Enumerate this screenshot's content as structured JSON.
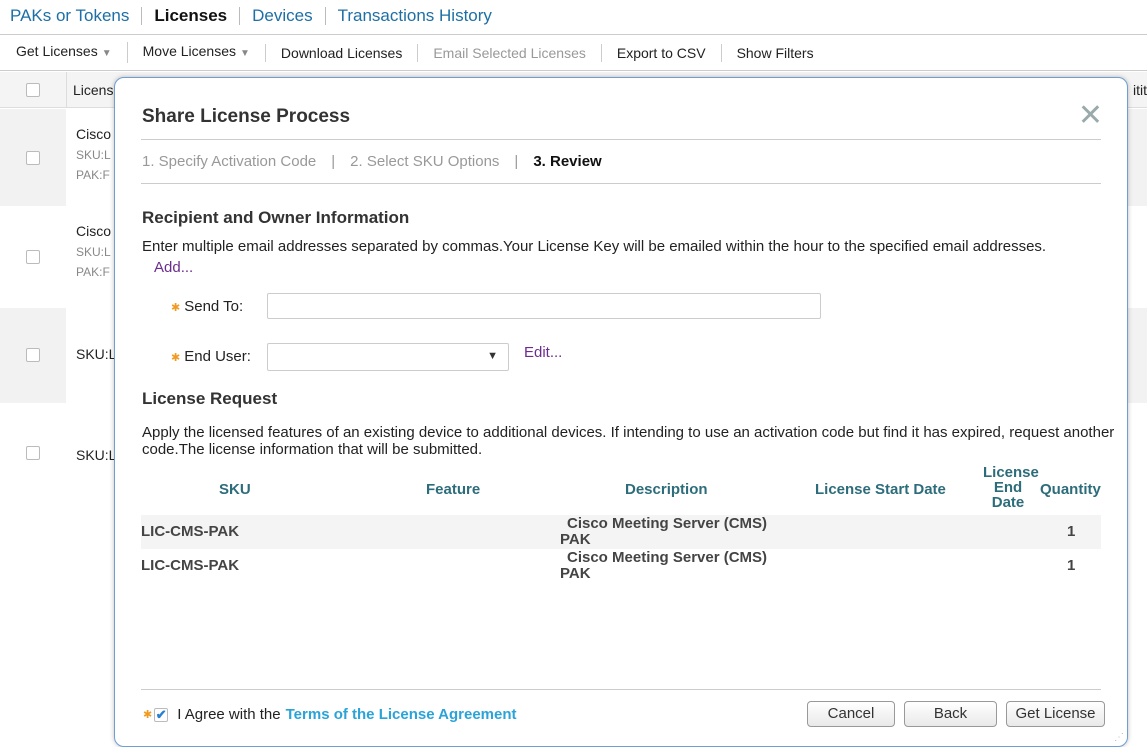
{
  "topnav": {
    "tabs": [
      "PAKs or Tokens",
      "Licenses",
      "Devices",
      "Transactions History"
    ]
  },
  "toolbar": {
    "get_licenses": "Get Licenses",
    "move_licenses": "Move Licenses",
    "download_licenses": "Download Licenses",
    "email_selected": "Email Selected Licenses",
    "export_csv": "Export to CSV",
    "show_filters": "Show Filters"
  },
  "bgtable": {
    "header_label": "Licens",
    "header_right": "itit",
    "rows": [
      {
        "l1": "Cisco",
        "l2": "SKU:L",
        "l3": "PAK:F"
      },
      {
        "l1": "Cisco",
        "l2": "SKU:L",
        "l3": "PAK:F"
      },
      {
        "l1": "SKU:L"
      },
      {
        "l1": "SKU:L"
      }
    ]
  },
  "modal": {
    "title": "Share License Process",
    "close_glyph": "✕",
    "steps": {
      "step1": "1. Specify Activation Code",
      "step2": "2. Select SKU Options",
      "step3": "3. Review",
      "separator": "|"
    },
    "recipient": {
      "title": "Recipient and Owner Information",
      "instructions": "Enter multiple email addresses separated by commas.Your License Key will be emailed within the hour to the specified email addresses.",
      "add_link": "Add...",
      "send_to_label": "Send To:",
      "send_to_value": "",
      "end_user_label": "End User:",
      "end_user_value": "",
      "edit_link": "Edit..."
    },
    "license_request": {
      "title": "License Request",
      "description": "Apply the licensed features of an existing device to additional devices. If intending to use an activation code but find it has expired, request another code.The license information that will be submitted.",
      "columns": {
        "sku": "SKU",
        "feature": "Feature",
        "description": "Description",
        "start_date": "License Start Date",
        "end_date_1": "License",
        "end_date_2": "End",
        "end_date_3": "Date",
        "quantity": "Quantity"
      },
      "rows": [
        {
          "sku": "LIC-CMS-PAK",
          "feature": "",
          "description_1": "Cisco Meeting Server (CMS)",
          "description_2": "PAK",
          "start_date": "",
          "end_date": "",
          "quantity": "1"
        },
        {
          "sku": "LIC-CMS-PAK",
          "feature": "",
          "description_1": "Cisco Meeting Server (CMS)",
          "description_2": "PAK",
          "start_date": "",
          "end_date": "",
          "quantity": "1"
        }
      ]
    },
    "footer": {
      "agree_text": "I Agree with the",
      "terms_link": "Terms of the License Agreement",
      "agree_checked": true,
      "cancel": "Cancel",
      "back": "Back",
      "get_license": "Get License"
    }
  },
  "colors": {
    "link_blue": "#1d6fa5",
    "link_purple": "#6b2c8e",
    "header_teal": "#2d6d7b",
    "terms_blue": "#2aa3d8",
    "required_orange": "#f29a1f",
    "modal_border": "#6f9ed0"
  }
}
